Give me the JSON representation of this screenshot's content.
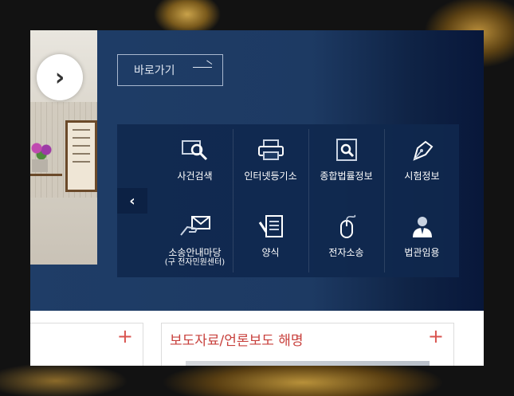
{
  "hero": {
    "next_arrow": "›",
    "goto_label": "바로가기",
    "prev_arrow": "‹"
  },
  "quick_menu": [
    {
      "label": "사건검색",
      "icon": "magnifier-screen-icon"
    },
    {
      "label": "인터넷등기소",
      "icon": "printer-icon"
    },
    {
      "label": "종합법률정보",
      "icon": "document-search-icon"
    },
    {
      "label": "시험정보",
      "icon": "pen-nib-icon"
    },
    {
      "label": "소송안내마당",
      "sub": "(구 전자민원센터)",
      "icon": "hand-envelope-icon"
    },
    {
      "label": "양식",
      "icon": "form-document-icon"
    },
    {
      "label": "전자소송",
      "icon": "mouse-icon"
    },
    {
      "label": "법관임용",
      "icon": "person-icon"
    }
  ],
  "cards": {
    "left_plus": "+",
    "right_title": "보도자료/언론보도 해명",
    "right_plus": "+"
  }
}
